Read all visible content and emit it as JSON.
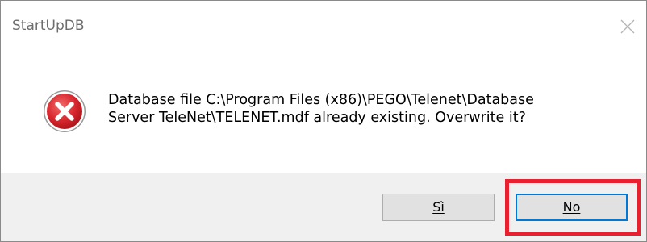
{
  "window": {
    "title": "StartUpDB",
    "close_icon": "close-icon"
  },
  "dialog": {
    "icon": "error-icon",
    "message_line1": "Database file C:\\Program Files (x86)\\PEGO\\Telenet\\Database",
    "message_line2": "Server TeleNet\\TELENET.mdf already existing. Overwrite it?"
  },
  "buttons": {
    "yes_label": "Sì",
    "no_label": "No",
    "default": "no"
  },
  "colors": {
    "error_red": "#d9343a",
    "focus_blue": "#0078d7",
    "highlight_red": "#e8202f"
  }
}
